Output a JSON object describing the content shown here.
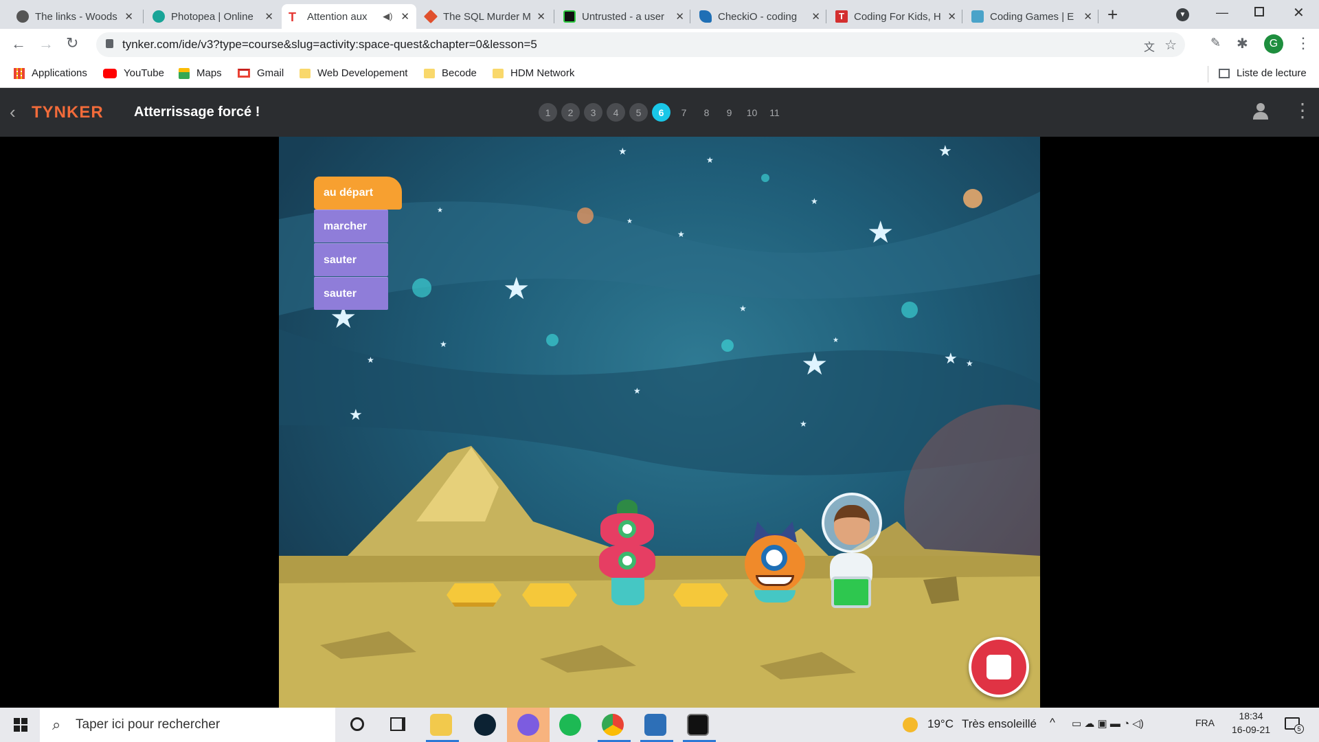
{
  "browser": {
    "tabs": [
      {
        "title": "The links - Woods",
        "icon": "github-icon",
        "color": "#555"
      },
      {
        "title": "Photopea | Online",
        "icon": "photopea-icon",
        "color": "#18a497"
      },
      {
        "title": "Attention aux",
        "icon": "tynker-icon",
        "color": "#e53935"
      },
      {
        "title": "The SQL Murder M",
        "icon": "sql-murder-icon",
        "color": "#e0502d"
      },
      {
        "title": "Untrusted - a user",
        "icon": "untrusted-icon",
        "color": "#111"
      },
      {
        "title": "CheckiO - coding",
        "icon": "checkio-icon",
        "color": "#1f6fb5"
      },
      {
        "title": "Coding For Kids, H",
        "icon": "tynker-t-icon",
        "color": "#d32f2f"
      },
      {
        "title": "Coding Games | E",
        "icon": "coding-games-icon",
        "color": "#4aa3c9"
      }
    ],
    "url": "tynker.com/ide/v3?type=course&slug=activity:space-quest&chapter=0&lesson=5",
    "avatar_letter": "G",
    "bookmarks": [
      "Applications",
      "YouTube",
      "Maps",
      "Gmail",
      "Web Developement",
      "Becode",
      "HDM Network"
    ],
    "reading_list": "Liste de lecture"
  },
  "app": {
    "logo": "TYNKER",
    "title": "Atterrissage forcé !",
    "lessons": [
      "1",
      "2",
      "3",
      "4",
      "5",
      "6",
      "7",
      "8",
      "9",
      "10",
      "11"
    ],
    "current_lesson": "6",
    "completed_count": 5
  },
  "code_blocks": [
    {
      "label": "au départ",
      "kind": "event",
      "color": "#f7a030"
    },
    {
      "label": "marcher",
      "kind": "action",
      "color": "#8f7dd9"
    },
    {
      "label": "sauter",
      "kind": "action",
      "color": "#8f7dd9"
    },
    {
      "label": "sauter",
      "kind": "action",
      "color": "#8f7dd9"
    }
  ],
  "taskbar": {
    "search_placeholder": "Taper ici pour rechercher",
    "weather_temp": "19°C",
    "weather_text": "Très ensoleillé",
    "lang": "FRA",
    "time": "18:34",
    "date": "16-09-21",
    "notif_count": "5"
  }
}
